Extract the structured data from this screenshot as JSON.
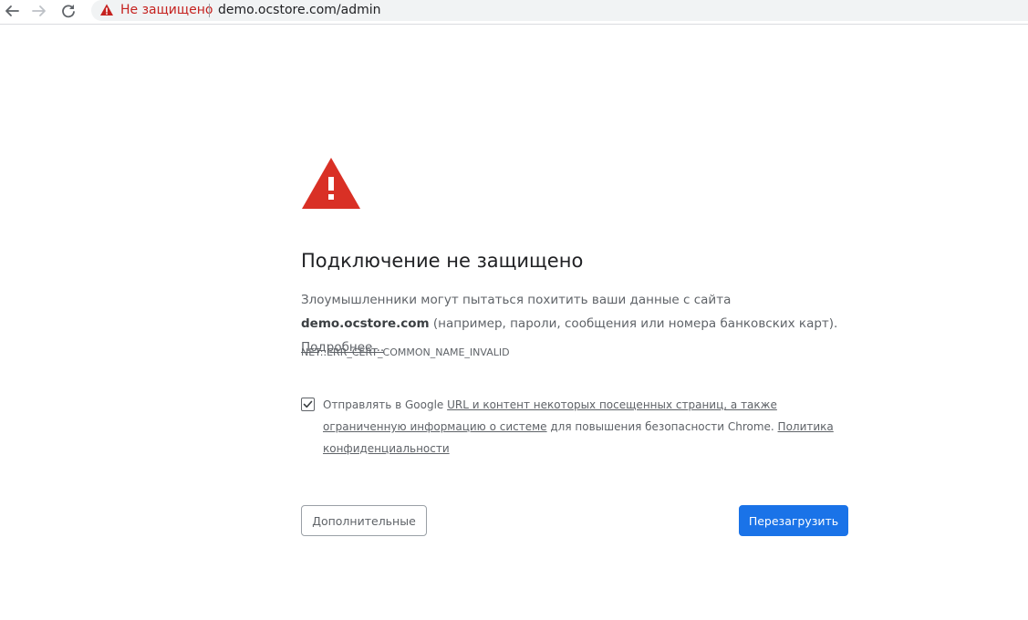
{
  "browser": {
    "security_label": "Не защищено",
    "url": "demo.ocstore.com/admin"
  },
  "page": {
    "heading": "Подключение не защищено",
    "body_intro": "Злоумышленники могут пытаться похитить ваши данные с сайта ",
    "body_site": "demo.ocstore.com",
    "body_rest": " (например, пароли, сообщения или номера банковских карт). ",
    "learn_more_link": "Подробнее...",
    "error_code": "NET::ERR_CERT_COMMON_NAME_INVALID",
    "optin": {
      "checked": true,
      "prefix": "Отправлять в Google ",
      "link1": "URL и контент некоторых посещенных страниц, а также ограниченную информацию о системе",
      "middle": " для повышения безопасности Chrome. ",
      "link2": "Политика конфиденциальности"
    },
    "advanced_button": "Дополнительные",
    "reload_button": "Перезагрузить"
  },
  "colors": {
    "warning_red": "#d93025",
    "primary_blue": "#1a73e8",
    "text_secondary": "#5f6368"
  }
}
